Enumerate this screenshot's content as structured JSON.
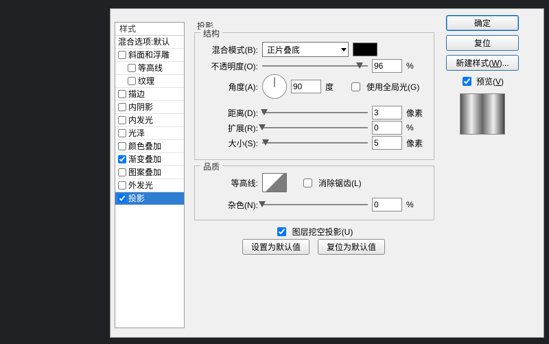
{
  "styles": {
    "header": "样式",
    "default_row": "混合选项:默认",
    "items": [
      {
        "label": "斜面和浮雕",
        "checked": false,
        "indent": false
      },
      {
        "label": "等高线",
        "checked": false,
        "indent": true
      },
      {
        "label": "纹理",
        "checked": false,
        "indent": true
      },
      {
        "label": "描边",
        "checked": false,
        "indent": false
      },
      {
        "label": "内阴影",
        "checked": false,
        "indent": false
      },
      {
        "label": "内发光",
        "checked": false,
        "indent": false
      },
      {
        "label": "光泽",
        "checked": false,
        "indent": false
      },
      {
        "label": "颜色叠加",
        "checked": false,
        "indent": false
      },
      {
        "label": "渐变叠加",
        "checked": true,
        "indent": false
      },
      {
        "label": "图案叠加",
        "checked": false,
        "indent": false
      },
      {
        "label": "外发光",
        "checked": false,
        "indent": false
      },
      {
        "label": "投影",
        "checked": true,
        "indent": false,
        "selected": true
      }
    ]
  },
  "panel": {
    "title": "投影",
    "structure": {
      "legend": "结构",
      "blend_mode_label": "混合模式(B):",
      "blend_mode_value": "正片叠底",
      "color": "#000000",
      "opacity_label": "不透明度(O):",
      "opacity_value": "96",
      "opacity_unit": "%",
      "angle_label": "角度(A):",
      "angle_value": "90",
      "angle_unit": "度",
      "global_light_label": "使用全局光(G)",
      "global_light_checked": false,
      "distance_label": "距离(D):",
      "distance_value": "3",
      "distance_unit": "像素",
      "spread_label": "扩展(R):",
      "spread_value": "0",
      "spread_unit": "%",
      "size_label": "大小(S):",
      "size_value": "5",
      "size_unit": "像素"
    },
    "quality": {
      "legend": "品质",
      "contour_label": "等高线:",
      "antialias_label": "消除锯齿(L)",
      "antialias_checked": false,
      "noise_label": "杂色(N):",
      "noise_value": "0",
      "noise_unit": "%"
    },
    "knockout": {
      "label": "图层挖空投影(U)",
      "checked": true
    },
    "buttons": {
      "make_default": "设置为默认值",
      "reset_default": "复位为默认值"
    }
  },
  "right": {
    "ok": "确定",
    "cancel": "复位",
    "new_style_a": "新建样式(",
    "new_style_u": "W",
    "new_style_b": ")...",
    "preview_a": "预览(",
    "preview_u": "V",
    "preview_b": ")",
    "preview_checked": true
  }
}
